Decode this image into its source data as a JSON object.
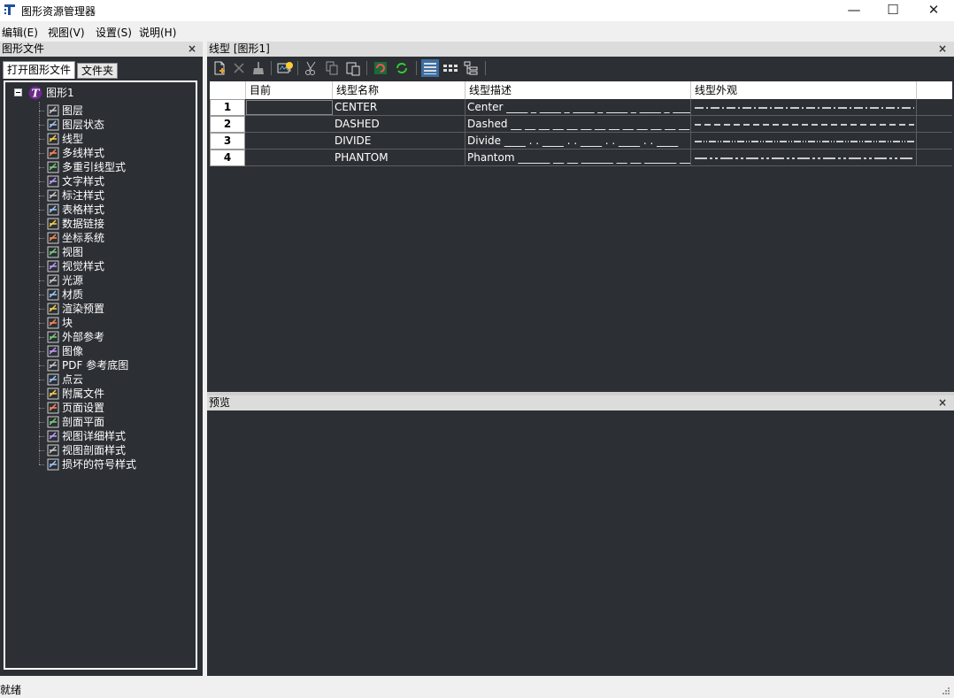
{
  "window": {
    "title": "图形资源管理器",
    "controls": {
      "minimize": "—",
      "maximize": "☐",
      "close": "✕"
    }
  },
  "menu": {
    "items": [
      {
        "label": "编辑(E)"
      },
      {
        "label": "视图(V)"
      },
      {
        "label": "设置(S)"
      },
      {
        "label": "说明(H)"
      }
    ]
  },
  "left_panel": {
    "title": "图形文件",
    "close": "×",
    "tabs": [
      {
        "label": "打开图形文件",
        "active": true
      },
      {
        "label": "文件夹",
        "active": false
      }
    ],
    "tree": {
      "root": {
        "label": "图形1",
        "expander": "−",
        "icon": "drawing-icon"
      },
      "items": [
        {
          "label": "图层",
          "icon": "layers-icon"
        },
        {
          "label": "图层状态",
          "icon": "layer-state-icon"
        },
        {
          "label": "线型",
          "icon": "linetype-icon"
        },
        {
          "label": "多线样式",
          "icon": "multiline-style-icon"
        },
        {
          "label": "多重引线型式",
          "icon": "multileader-style-icon"
        },
        {
          "label": "文字样式",
          "icon": "text-style-icon"
        },
        {
          "label": "标注样式",
          "icon": "dimension-style-icon"
        },
        {
          "label": "表格样式",
          "icon": "table-style-icon"
        },
        {
          "label": "数据链接",
          "icon": "data-link-icon"
        },
        {
          "label": "坐标系统",
          "icon": "ucs-icon"
        },
        {
          "label": "视图",
          "icon": "view-eye-icon"
        },
        {
          "label": "视觉样式",
          "icon": "visual-style-icon"
        },
        {
          "label": "光源",
          "icon": "light-icon"
        },
        {
          "label": "材质",
          "icon": "material-icon"
        },
        {
          "label": "渲染预置",
          "icon": "render-preset-icon"
        },
        {
          "label": "块",
          "icon": "block-icon"
        },
        {
          "label": "外部参考",
          "icon": "xref-icon"
        },
        {
          "label": "图像",
          "icon": "image-icon"
        },
        {
          "label": "PDF 参考底图",
          "icon": "pdf-underlay-icon"
        },
        {
          "label": "点云",
          "icon": "point-cloud-icon"
        },
        {
          "label": "附属文件",
          "icon": "attached-file-icon"
        },
        {
          "label": "页面设置",
          "icon": "page-setup-icon"
        },
        {
          "label": "剖面平面",
          "icon": "section-plane-icon"
        },
        {
          "label": "视图详细样式",
          "icon": "detail-view-style-icon"
        },
        {
          "label": "视图剖面样式",
          "icon": "section-view-style-icon"
        },
        {
          "label": "损坏的符号样式",
          "icon": "broken-symbol-style-icon"
        }
      ]
    }
  },
  "linetype_panel": {
    "title": "线型 [图形1]",
    "close": "×",
    "toolbar": [
      {
        "name": "new-icon"
      },
      {
        "name": "delete-icon"
      },
      {
        "name": "purge-icon"
      },
      {
        "name": "set-current-icon"
      },
      {
        "name": "cut-icon"
      },
      {
        "name": "copy-icon"
      },
      {
        "name": "paste-icon"
      },
      {
        "name": "refresh-red-icon"
      },
      {
        "name": "refresh-green-icon"
      },
      {
        "name": "detail-view-icon"
      },
      {
        "name": "list-view-icon"
      },
      {
        "name": "tree-view-icon"
      }
    ],
    "columns": [
      "目前",
      "线型名称",
      "线型描述",
      "线型外观"
    ],
    "rows": [
      {
        "num": "1",
        "current": "",
        "name": "CENTER",
        "description": "Center ____ _ ____ _ ____ _ ____ _ ____ _ ____",
        "pattern": "10 3 2 3"
      },
      {
        "num": "2",
        "current": "",
        "name": "DASHED",
        "description": "Dashed __ __ __ __ __ __ __ __ __ __ __ __ __ _",
        "pattern": "7 4"
      },
      {
        "num": "3",
        "current": "",
        "name": "DIVIDE",
        "description": "Divide ____ . . ____ . . ____ . . ____ . . ____",
        "pattern": "8 2 1 2 1 2"
      },
      {
        "num": "4",
        "current": "",
        "name": "PHANTOM",
        "description": "Phantom ______ __ __ ______ __ __ ______ __ __",
        "pattern": "14 3 3 3 3 3"
      }
    ]
  },
  "preview_panel": {
    "title": "预览",
    "close": "×"
  },
  "status": {
    "text": "就绪"
  }
}
